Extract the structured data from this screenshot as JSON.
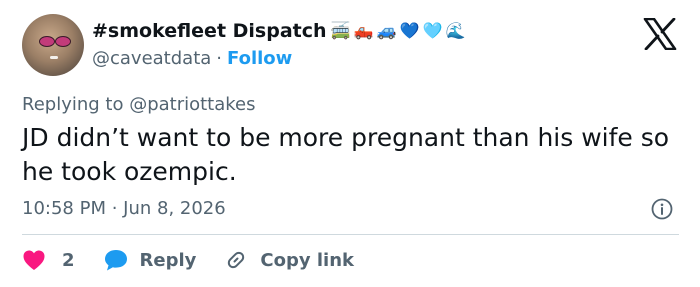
{
  "author": {
    "display_name": "#smokefleet Dispatch",
    "name_emojis": [
      {
        "glyph": "🚎",
        "name": "trolleybus-emoji"
      },
      {
        "glyph": "🛻",
        "name": "pickup-truck-emoji"
      },
      {
        "glyph": "🚙",
        "name": "suv-emoji"
      },
      {
        "glyph": "💙",
        "name": "blue-heart-emoji"
      },
      {
        "glyph": "🩵",
        "name": "light-blue-heart-emoji"
      },
      {
        "glyph": "🌊",
        "name": "wave-emoji"
      }
    ],
    "handle": "@caveatdata",
    "separator": "·",
    "follow_label": "Follow"
  },
  "reply_context": "Replying to @patriottakes",
  "tweet": {
    "text": "JD didn’t want to be more pregnant than his wife so he took ozempic.",
    "timestamp": "10:58 PM · Jun 8, 2026"
  },
  "actions": {
    "like_count": "2",
    "reply_label": "Reply",
    "copy_link_label": "Copy link"
  },
  "colors": {
    "text": "#0f1419",
    "muted": "#536471",
    "link": "#1d9bf0",
    "like": "#f91880",
    "divider": "#cfd9de"
  },
  "icons": {
    "platform": "x-logo-icon",
    "info": "info-icon",
    "like": "heart-icon",
    "reply": "speech-bubble-icon",
    "copy": "link-icon"
  }
}
